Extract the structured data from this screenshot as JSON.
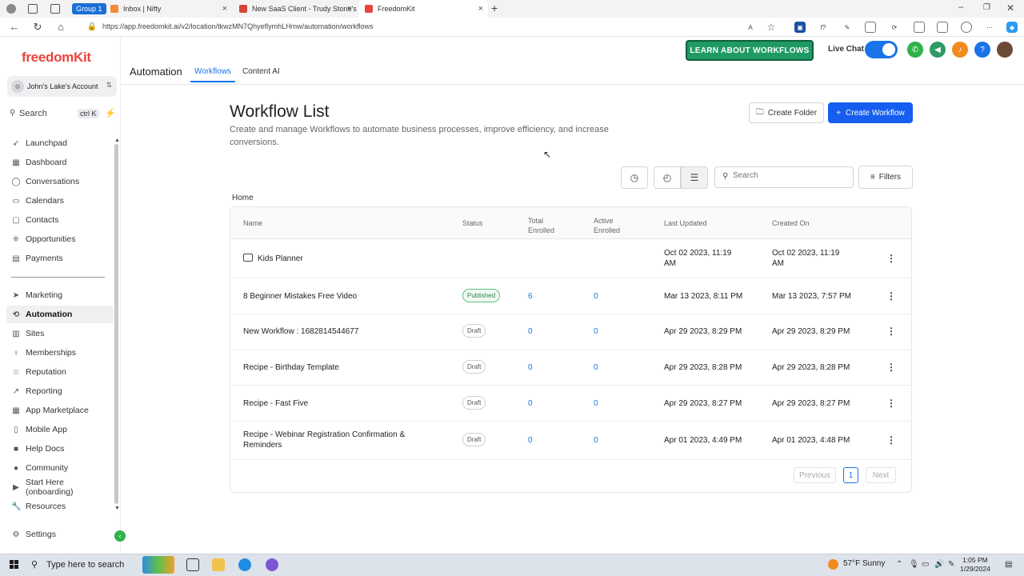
{
  "browser": {
    "group_label": "Group 1",
    "tabs": [
      {
        "title": "Inbox | Nifty"
      },
      {
        "title": "New SaaS Client - Trudy Stone's"
      },
      {
        "title": "FreedomKit"
      }
    ],
    "url": "https://app.freedomkit.ai/v2/location/tkwzMN7QhyeflymhLHmw/automation/workflows"
  },
  "sidebar": {
    "logo": "freedomKit",
    "account_name": "John's Lake's Account",
    "search_label": "Search",
    "search_shortcut": "ctrl K",
    "items_top": [
      {
        "label": "Launchpad",
        "icon": "rocket-icon"
      },
      {
        "label": "Dashboard",
        "icon": "grid-icon"
      },
      {
        "label": "Conversations",
        "icon": "chat-icon"
      },
      {
        "label": "Calendars",
        "icon": "calendar-icon"
      },
      {
        "label": "Contacts",
        "icon": "contacts-icon"
      },
      {
        "label": "Opportunities",
        "icon": "funnel-icon"
      },
      {
        "label": "Payments",
        "icon": "payments-icon"
      }
    ],
    "items_bottom": [
      {
        "label": "Marketing",
        "icon": "send-icon"
      },
      {
        "label": "Automation",
        "icon": "automation-icon"
      },
      {
        "label": "Sites",
        "icon": "sites-icon"
      },
      {
        "label": "Memberships",
        "icon": "membership-icon"
      },
      {
        "label": "Reputation",
        "icon": "star-icon"
      },
      {
        "label": "Reporting",
        "icon": "chart-icon"
      },
      {
        "label": "App Marketplace",
        "icon": "apps-icon"
      },
      {
        "label": "Mobile App",
        "icon": "mobile-icon"
      },
      {
        "label": "Help Docs",
        "icon": "book-icon"
      },
      {
        "label": "Community",
        "icon": "community-icon"
      },
      {
        "label": "Start Here (onboarding)",
        "icon": "play-icon"
      },
      {
        "label": "Resources",
        "icon": "wrench-icon"
      }
    ],
    "settings_label": "Settings"
  },
  "header": {
    "section_title": "Automation",
    "tabs": [
      {
        "label": "Workflows"
      },
      {
        "label": "Content AI"
      }
    ],
    "learn_button": "LEARN ABOUT WORKFLOWS",
    "live_chat_label": "Live Chat"
  },
  "main": {
    "title": "Workflow List",
    "description": "Create and manage Workflows to automate business processes, improve efficiency, and increase conversions.",
    "create_folder": "Create Folder",
    "create_workflow": "Create Workflow",
    "search_placeholder": "Search",
    "filters": "Filters",
    "breadcrumb": "Home",
    "columns": [
      "Name",
      "Status",
      "Total Enrolled",
      "Active Enrolled",
      "Last Updated",
      "Created On"
    ],
    "rows": [
      {
        "name": "Kids Planner",
        "status": "",
        "total": "",
        "active": "",
        "updated": "Oct 02 2023, 11:19 AM",
        "created": "Oct 02 2023, 11:19 AM"
      },
      {
        "name": "8 Beginner Mistakes Free Video",
        "status": "Published",
        "total": "6",
        "active": "0",
        "updated": "Mar 13 2023, 8:11 PM",
        "created": "Mar 13 2023, 7:57 PM"
      },
      {
        "name": "New Workflow : 1682814544677",
        "status": "Draft",
        "total": "0",
        "active": "0",
        "updated": "Apr 29 2023, 8:29 PM",
        "created": "Apr 29 2023, 8:29 PM"
      },
      {
        "name": "Recipe - Birthday Template",
        "status": "Draft",
        "total": "0",
        "active": "0",
        "updated": "Apr 29 2023, 8:28 PM",
        "created": "Apr 29 2023, 8:28 PM"
      },
      {
        "name": "Recipe - Fast Five",
        "status": "Draft",
        "total": "0",
        "active": "0",
        "updated": "Apr 29 2023, 8:27 PM",
        "created": "Apr 29 2023, 8:27 PM"
      },
      {
        "name": "Recipe - Webinar Registration Confirmation & Reminders",
        "status": "Draft",
        "total": "0",
        "active": "0",
        "updated": "Apr 01 2023, 4:49 PM",
        "created": "Apr 01 2023, 4:48 PM"
      }
    ],
    "pagination": {
      "previous": "Previous",
      "current": "1",
      "next": "Next"
    }
  },
  "taskbar": {
    "search_placeholder": "Type here to search",
    "weather": "57°F  Sunny",
    "time": "1:05 PM",
    "date": "1/29/2024"
  },
  "colors": {
    "brand": "#e8453c",
    "primary": "#155eef",
    "learn_green": "#1f9a63"
  }
}
